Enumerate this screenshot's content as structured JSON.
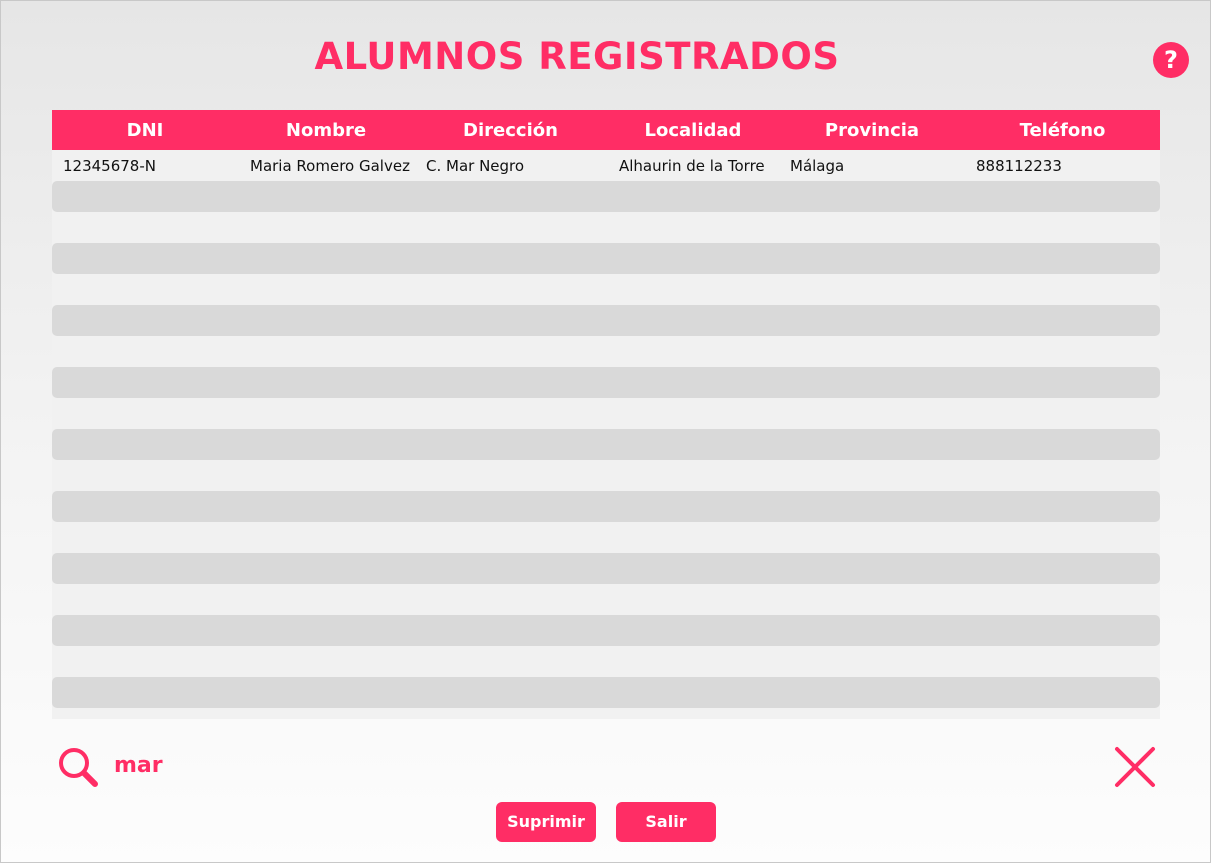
{
  "window": {
    "title": "ALUMNOS REGISTRADOS",
    "help_label": "?"
  },
  "colors": {
    "accent": "#ff2d65",
    "row_alt": "#d9d9d9",
    "row_base": "#f1f1f1"
  },
  "table": {
    "columns": [
      "DNI",
      "Nombre",
      "Dirección",
      "Localidad",
      "Provincia",
      "Teléfono"
    ],
    "rows": [
      [
        "12345678-N",
        "Maria Romero Galvez",
        "C. Mar Negro",
        "Alhaurin de la Torre",
        "Málaga",
        "888112233"
      ]
    ],
    "empty_rows": 17
  },
  "search": {
    "value": "mar",
    "icon": "search-icon"
  },
  "actions": {
    "clear_icon": "close-icon",
    "delete_label": "Suprimir",
    "exit_label": "Salir"
  }
}
